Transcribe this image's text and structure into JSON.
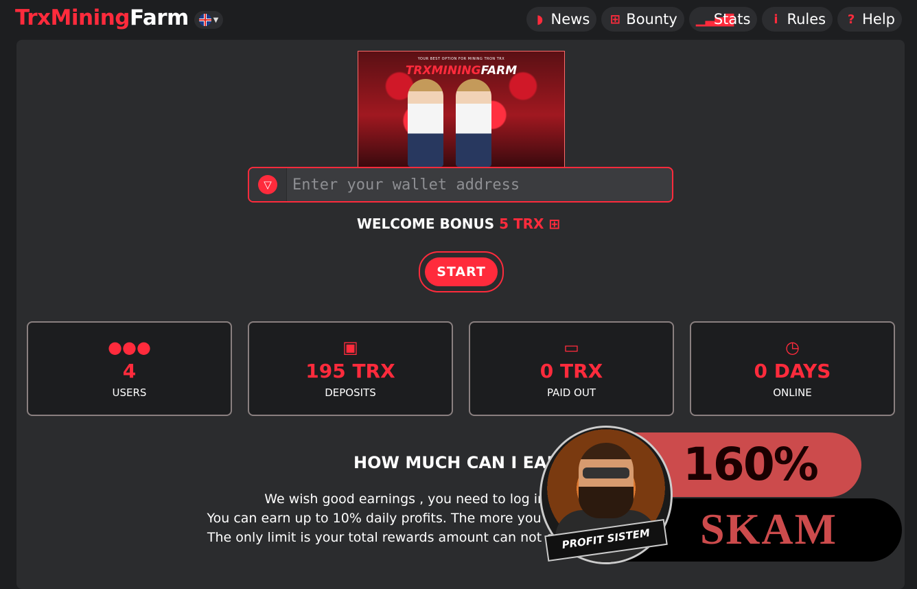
{
  "header": {
    "logo_part1": "TrxMining",
    "logo_part2": "Farm",
    "nav": [
      {
        "label": "News",
        "icon": "rss-icon"
      },
      {
        "label": "Bounty",
        "icon": "gift-icon"
      },
      {
        "label": "Stats",
        "icon": "signal-icon"
      },
      {
        "label": "Rules",
        "icon": "info-icon"
      },
      {
        "label": "Help",
        "icon": "question-icon"
      }
    ]
  },
  "banner": {
    "tagline": "YOUR BEST OPTION FOR MINING TRON TRX",
    "title_part1": "TRXMINING",
    "title_part2": "FARM"
  },
  "wallet": {
    "placeholder": "Enter your wallet address"
  },
  "bonus": {
    "label": "WELCOME BONUS",
    "value": "5 TRX"
  },
  "start_label": "START",
  "stats": [
    {
      "value": "4",
      "label": "USERS",
      "icon": "users-icon"
    },
    {
      "value": "195 TRX",
      "label": "DEPOSITS",
      "icon": "briefcase-icon"
    },
    {
      "value": "0 TRX",
      "label": "PAID OUT",
      "icon": "money-icon"
    },
    {
      "value": "0 DAYS",
      "label": "ONLINE",
      "icon": "clock-icon"
    }
  ],
  "earn": {
    "title": "HOW MUCH CAN I EARN",
    "lines": [
      "We wish good earnings , you need to log in to your account",
      "You can earn up to 10% daily profits. The more you invest the more you earn",
      "The only limit is your total rewards amount can not exceed 160% of deposits"
    ]
  },
  "overlay": {
    "percent": "160%",
    "verdict": "SKAM",
    "ribbon": "PROFIT SISTEM"
  },
  "colors": {
    "accent": "#ff2b3c",
    "background": "#1d1e20",
    "panel": "#2b2c2e",
    "badge": "#cc4b4c"
  }
}
